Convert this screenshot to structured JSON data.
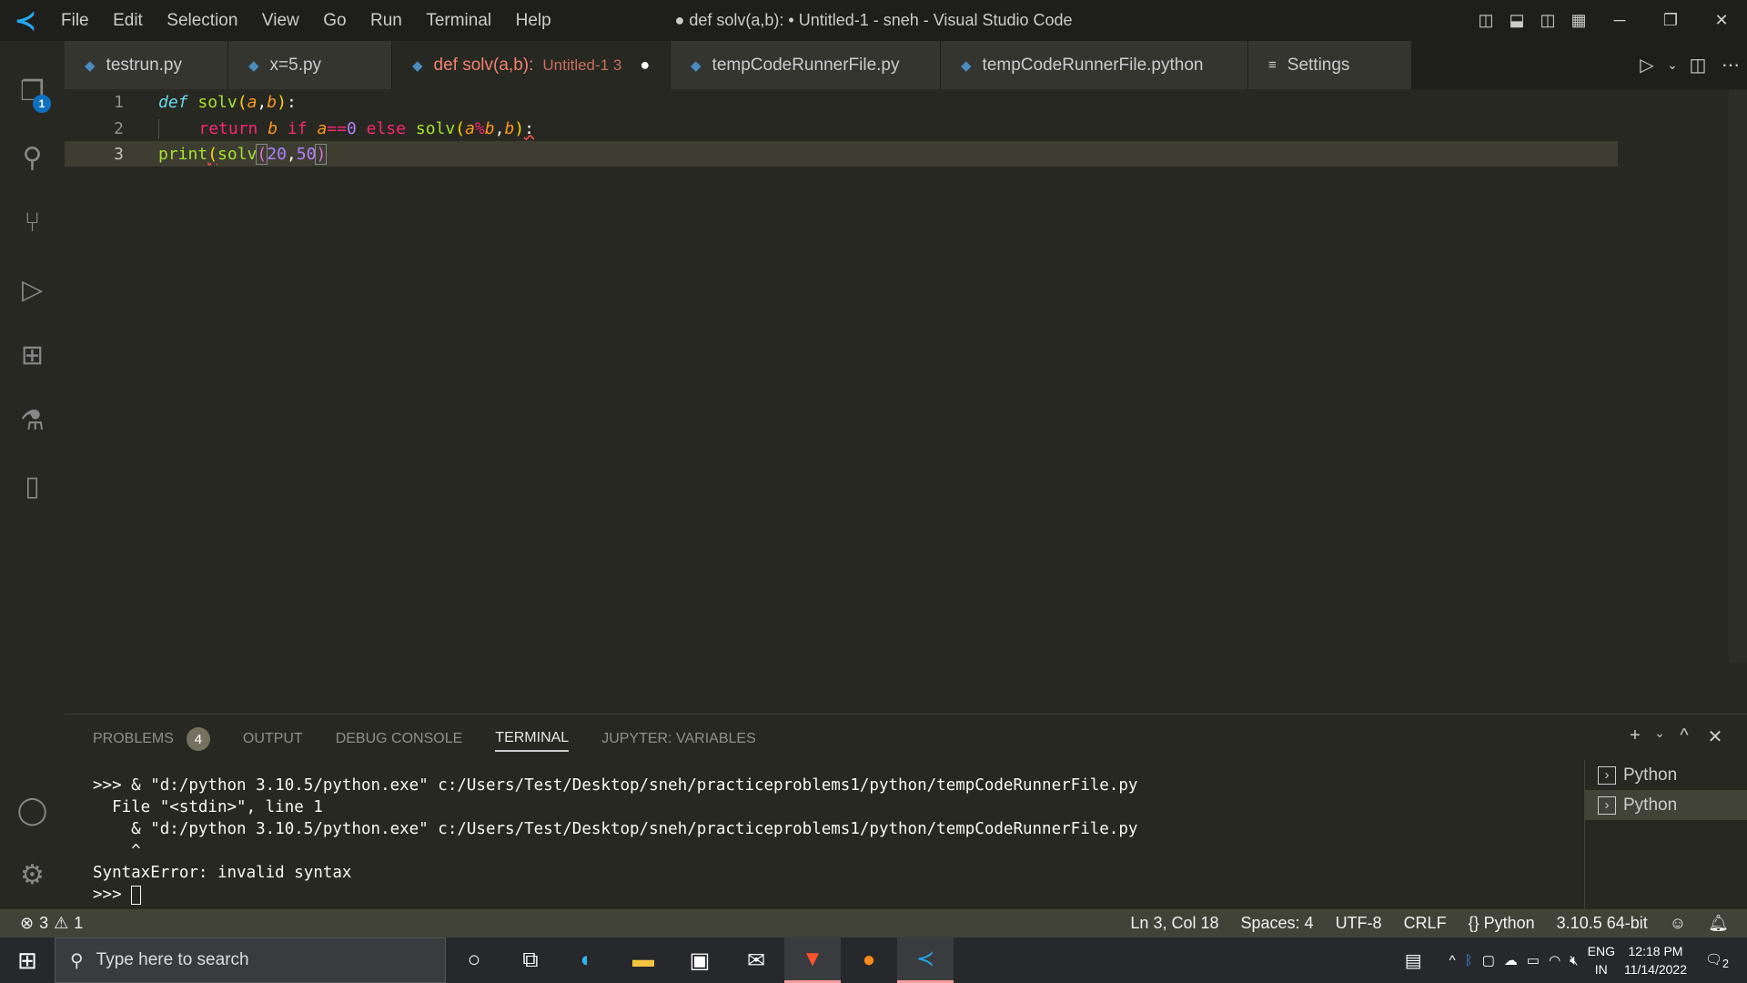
{
  "window": {
    "title": "● def solv(a,b): • Untitled-1 - sneh - Visual Studio Code",
    "menu": [
      "File",
      "Edit",
      "Selection",
      "View",
      "Go",
      "Run",
      "Terminal",
      "Help"
    ]
  },
  "activity": {
    "explorer_badge": "1"
  },
  "tabs": [
    {
      "label": "testrun.py"
    },
    {
      "label": "x=5.py"
    },
    {
      "label": "def solv(a,b):",
      "sub": "Untitled-1 3",
      "dirty": true,
      "active": true
    },
    {
      "label": "tempCodeRunnerFile.py"
    },
    {
      "label": "tempCodeRunnerFile.python"
    },
    {
      "label": "Settings"
    }
  ],
  "editor": {
    "line_numbers": [
      "1",
      "2",
      "3"
    ],
    "line1": {
      "kw": "def",
      "fn": "solv",
      "p1": "(",
      "a": "a",
      "c": ",",
      "b": "b",
      "p2": ")",
      "col": ":"
    },
    "line2": {
      "ret": "return",
      "b": "b",
      "if": "if",
      "a": "a",
      "eq": "==",
      "zero": "0",
      "else": "else",
      "fn": "solv",
      "p1": "(",
      "a2": "a",
      "mod": "%",
      "b2": "b",
      "c": ",",
      "b3": "b",
      "p2": ")",
      "col": ":"
    },
    "line3": {
      "fn": "print",
      "p1": "(",
      "fn2": "solv",
      "p2": "(",
      "n1": "20",
      "c": ",",
      "n2": "50",
      "p3": ")"
    }
  },
  "panel": {
    "tabs": [
      "PROBLEMS",
      "OUTPUT",
      "DEBUG CONSOLE",
      "TERMINAL",
      "JUPYTER: VARIABLES"
    ],
    "problems_count": "4",
    "active": "TERMINAL",
    "terminal_lines": [
      ">>> & \"d:/python 3.10.5/python.exe\" c:/Users/Test/Desktop/sneh/practiceproblems1/python/tempCodeRunnerFile.py",
      "  File \"<stdin>\", line 1",
      "    & \"d:/python 3.10.5/python.exe\" c:/Users/Test/Desktop/sneh/practiceproblems1/python/tempCodeRunnerFile.py",
      "    ^",
      "SyntaxError: invalid syntax"
    ],
    "prompt": ">>> ",
    "terminals": [
      "Python",
      "Python"
    ]
  },
  "status": {
    "errors": "3",
    "warnings": "1",
    "position": "Ln 3, Col 18",
    "spaces": "Spaces: 4",
    "encoding": "UTF-8",
    "eol": "CRLF",
    "language": "Python",
    "interpreter": "3.10.5 64-bit"
  },
  "taskbar": {
    "search_placeholder": "Type here to search",
    "lang1": "ENG",
    "lang2": "IN",
    "time": "12:18 PM",
    "date": "11/14/2022",
    "notifications": "2"
  }
}
